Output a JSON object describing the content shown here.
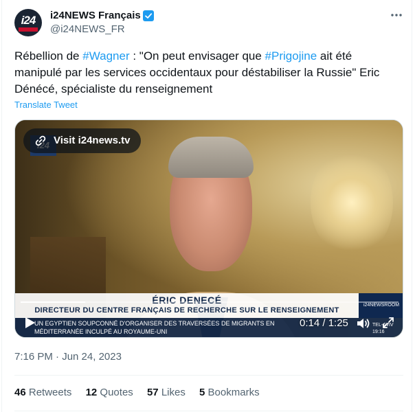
{
  "account": {
    "name": "i24NEWS Français",
    "handle": "@i24NEWS_FR",
    "avatar_text": "i24"
  },
  "tweet": {
    "t1": "Rébellion de ",
    "tag1": "#Wagner",
    "t2": " : \"On peut envisager que ",
    "tag2": "#Prigojine",
    "t3": " ait été manipulé par les services occidentaux pour déstabiliser la Russie\" Eric Dénécé, spécialiste du renseignement",
    "translate_label": "Translate Tweet"
  },
  "video": {
    "visit_label": "Visit i24news.tv",
    "corner_logo": "i24",
    "lower_third_name": "ÉRIC DENECÉ",
    "lower_third_title": "DIRECTEUR DU CENTRE FRANÇAIS DE RECHERCHE SUR LE RENSEIGNEMENT",
    "newsroom_label": "i24NEWSROOM",
    "ticker_text": "UN EGYPTIEN SOUPCONNÉ D'ORGANISER DES TRAVERSÉES DE MIGRANTS EN MÉDITERRANÉE INCULPÉ AU ROYAUME-UNI",
    "ticker_city": "TEL-AVIV 19:16",
    "time_display": "0:14 / 1:25",
    "progress_fraction": 0.17
  },
  "timestamp": "7:16 PM · Jun 24, 2023",
  "stats": {
    "retweets_count": "46",
    "retweets_label": "Retweets",
    "quotes_count": "12",
    "quotes_label": "Quotes",
    "likes_count": "57",
    "likes_label": "Likes",
    "bookmarks_count": "5",
    "bookmarks_label": "Bookmarks"
  },
  "colors": {
    "accent": "#1d9bf0",
    "text": "#0f1419",
    "muted": "#536471"
  },
  "icons": [
    "verified-badge-icon",
    "more-icon",
    "link-icon",
    "play-icon",
    "volume-icon",
    "fullscreen-icon"
  ]
}
